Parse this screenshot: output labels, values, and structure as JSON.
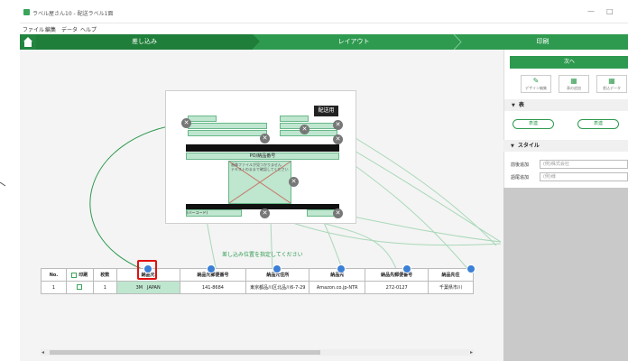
{
  "window": {
    "title": "ラベル屋さん10 - 配送ラベル1面",
    "controls": [
      "—",
      "□"
    ]
  },
  "menu": [
    "ファイル",
    "編集",
    "データ",
    "ヘルプ"
  ],
  "steps": {
    "active": "差し込み",
    "second": "レイアウト",
    "third": "印刷"
  },
  "label": {
    "stamp": "配送用",
    "po_field": "PO/納品番号",
    "image_note_1": "画像ファイルが見つかりません",
    "image_note_2": "テキストのままで確認してください",
    "barcode_field": "(バーコード)"
  },
  "hint": "差し込み位置を指定してください",
  "table": {
    "headers": [
      "No.",
      "印刷",
      "枚数",
      "納品元",
      "納品元郵便番号",
      "納品元住所",
      "納品先",
      "納品先郵便番号",
      "納品先住"
    ],
    "rows": [
      [
        "1",
        "",
        "1",
        "3M　JAPAN",
        "141-8684",
        "東京都品川区北品川6-7-29",
        "Amazon.co.jp-NTR",
        "272-0127",
        "千葉県市川"
      ]
    ]
  },
  "panel": {
    "next_label": "次へ",
    "tools": [
      "デザイン編集",
      "表の追加",
      "差込データ"
    ],
    "section_table": "表",
    "pill_left": "表連",
    "pill_right": "表連",
    "section_style": "スタイル",
    "field_prefix_label": "前後追加",
    "field_prefix_value": "(例)株式会社",
    "field_suffix_label": "語尾追加",
    "field_suffix_value": "(例)様"
  },
  "colors": {
    "accent": "#2e9a4f",
    "highlight": "#bfe6cf",
    "marker": "#3b7fd6",
    "callout": "#e01010"
  }
}
